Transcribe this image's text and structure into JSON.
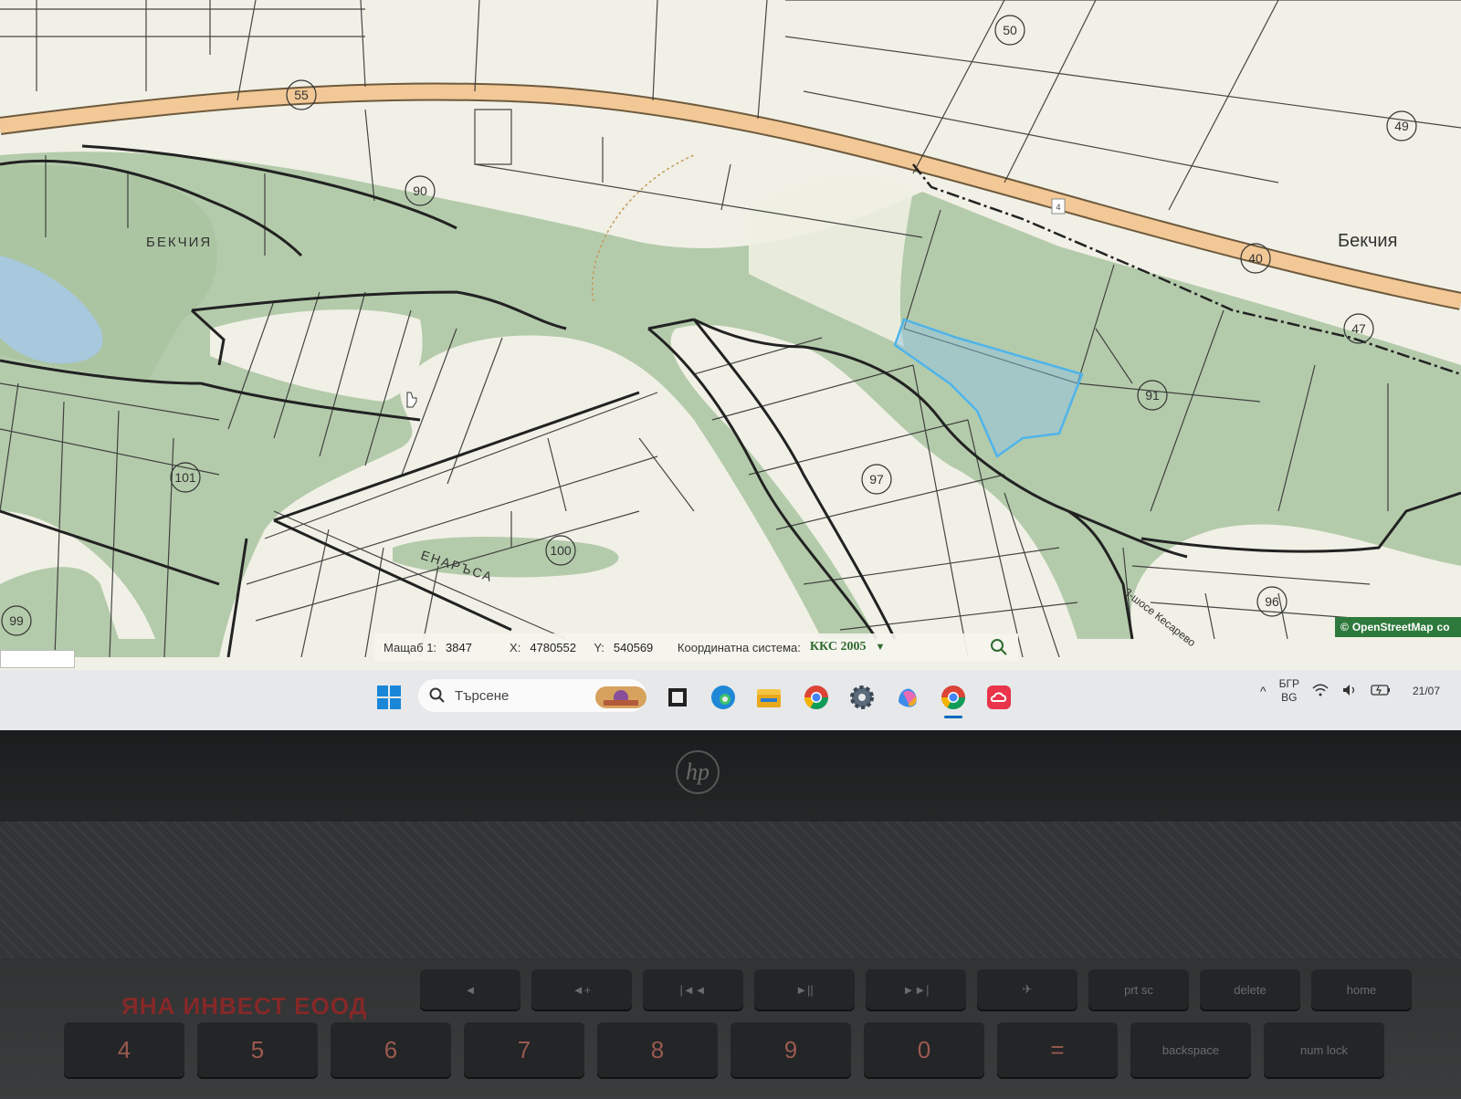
{
  "map": {
    "labels": {
      "bekchia_left": "БЕКЧИЯ",
      "bekchia_right": "Бекчия",
      "enarasa": "ЕНАРЪСА",
      "road": "3-шосе Кесарево",
      "road_number": "4"
    },
    "parcels": [
      "55",
      "50",
      "49",
      "90",
      "40",
      "47",
      "91",
      "97",
      "101",
      "100",
      "96",
      "99"
    ],
    "attribution": "OpenStreetMap",
    "attribution_suffix": "co"
  },
  "status_bar": {
    "scale_label": "Мащаб 1:",
    "scale_value": "3847",
    "x_label": "X:",
    "x_value": "4780552",
    "y_label": "Y:",
    "y_value": "540569",
    "crs_label": "Координатна система:",
    "crs_value": "ККС 2005"
  },
  "taskbar": {
    "search_placeholder": "Търсене",
    "lang_top": "БГР",
    "lang_bottom": "BG",
    "date": "21/07"
  },
  "laptop": {
    "logo": "hp",
    "watermark": "ЯНА ИНВЕСТ ЕООД",
    "keys_fn": [
      "◄",
      "◄+",
      "|◄◄",
      "►||",
      "►►|",
      "✈",
      "prt sc",
      "delete",
      "home"
    ],
    "keys_num": [
      "4",
      "5",
      "6",
      "7",
      "8",
      "9",
      "0",
      "=",
      "backspace",
      "num lock"
    ]
  },
  "colors": {
    "map_bg": "#f1f0e6",
    "forest": "#a9c4a0",
    "road": "#f2c896",
    "selection": "#4fb4ea",
    "water": "#a8c8de"
  }
}
